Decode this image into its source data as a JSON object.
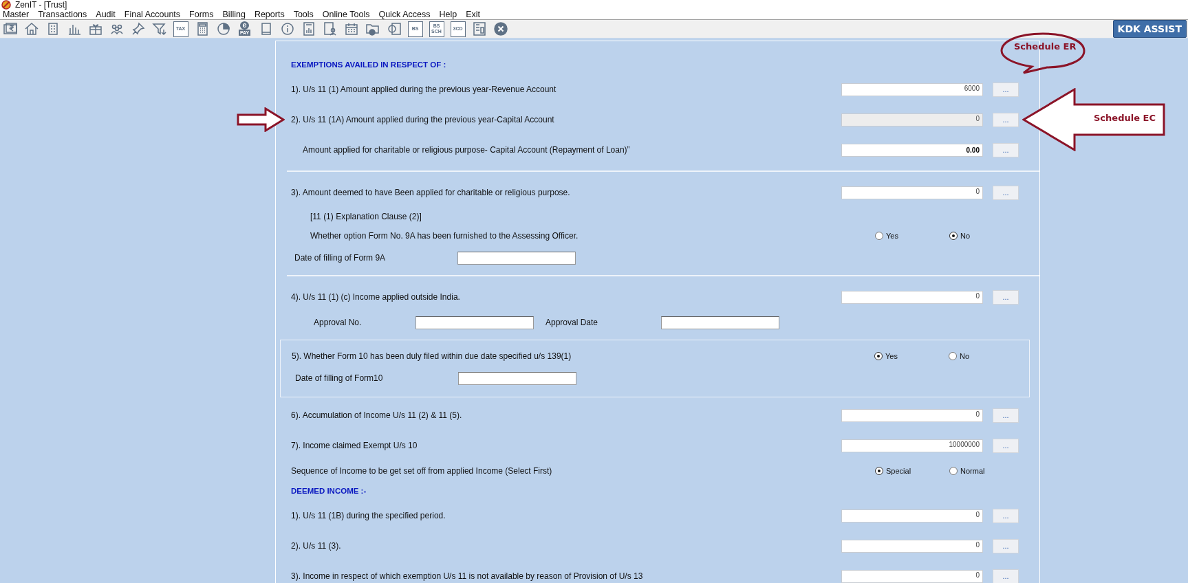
{
  "window": {
    "title": "ZenIT - [Trust]"
  },
  "menu": [
    "Master",
    "Transactions",
    "Audit",
    "Final Accounts",
    "Forms",
    "Billing",
    "Reports",
    "Tools",
    "Online Tools",
    "Quick Access",
    "Help",
    "Exit"
  ],
  "toolbar": [
    {
      "kind": "money"
    },
    {
      "kind": "home"
    },
    {
      "kind": "building"
    },
    {
      "kind": "chart"
    },
    {
      "kind": "gift"
    },
    {
      "kind": "people"
    },
    {
      "kind": "pin"
    },
    {
      "kind": "filter"
    },
    {
      "kind": "tag",
      "label": "TAX"
    },
    {
      "kind": "calculator"
    },
    {
      "kind": "pie"
    },
    {
      "kind": "epay",
      "mark": "e",
      "label": "PAY"
    },
    {
      "kind": "book"
    },
    {
      "kind": "info"
    },
    {
      "kind": "report"
    },
    {
      "kind": "user"
    },
    {
      "kind": "calendar"
    },
    {
      "kind": "folder"
    },
    {
      "kind": "window"
    },
    {
      "kind": "tag",
      "label": "BS"
    },
    {
      "kind": "tag2",
      "label": "BS",
      "sublabel": "SCH"
    },
    {
      "kind": "tag",
      "label": "3CD"
    },
    {
      "kind": "sheet"
    },
    {
      "kind": "close"
    }
  ],
  "assist_button": "KDK ASSIST",
  "rows": [
    {
      "kind": "heading",
      "text": "EXEMPTIONS AVAILED IN RESPECT OF :"
    },
    {
      "kind": "amount",
      "label": "1). U/s 11 (1) Amount applied during the previous year-Revenue Account",
      "value": "6000",
      "disabled": false,
      "emphasis": false,
      "button": "..."
    },
    {
      "kind": "amount",
      "label": "2). U/s 11 (1A) Amount applied during the previous year-Capital Account",
      "value": "0",
      "disabled": true,
      "emphasis": false,
      "button": "..."
    },
    {
      "kind": "sub_amount",
      "label": "Amount applied for charitable or religious purpose- Capital Account (Repayment of Loan)”",
      "value": "0.00",
      "disabled": false,
      "emphasis": true,
      "button": "..."
    },
    {
      "kind": "divider"
    },
    {
      "kind": "amount",
      "label": "3).  Amount deemed to have Been applied for charitable or religious purpose.",
      "value": "0",
      "disabled": false,
      "emphasis": false,
      "button": "..."
    },
    {
      "kind": "note",
      "text": "[11 (1) Explanation Clause (2)]"
    },
    {
      "kind": "choice",
      "indented": true,
      "label": "Whether option Form No. 9A has been furnished to the Assessing Officer.",
      "options": [
        {
          "label": "Yes",
          "selected": false
        },
        {
          "label": "No",
          "selected": true
        }
      ]
    },
    {
      "kind": "date",
      "label": "Date of filling of Form 9A"
    },
    {
      "kind": "divider"
    },
    {
      "kind": "amount",
      "label": "4).  U/s 11 (1) (c) Income applied outside India.",
      "value": "0",
      "disabled": false,
      "emphasis": false,
      "button": "..."
    },
    {
      "kind": "approval",
      "fields": [
        {
          "label": "Approval No."
        },
        {
          "label": "Approval Date"
        }
      ]
    },
    {
      "kind": "section",
      "rows": [
        {
          "kind": "choice",
          "indented": false,
          "label": "5). Whether Form 10 has been duly filed within due date specified u/s 139(1)",
          "options": [
            {
              "label": "Yes",
              "selected": true
            },
            {
              "label": "No",
              "selected": false
            }
          ]
        },
        {
          "kind": "date",
          "label": "Date of filling of Form10"
        }
      ]
    },
    {
      "kind": "amount",
      "label": "6).  Accumulation of Income U/s 11 (2) & 11 (5).",
      "value": "0",
      "disabled": false,
      "emphasis": false,
      "button": "..."
    },
    {
      "kind": "amount",
      "label": "7).  Income claimed Exempt U/s 10",
      "value": "10000000",
      "disabled": false,
      "emphasis": false,
      "button": "..."
    },
    {
      "kind": "choice",
      "indented": false,
      "label": "Sequence of Income to be get set off from applied Income (Select First)",
      "options": [
        {
          "label": "Special",
          "selected": true
        },
        {
          "label": "Normal",
          "selected": false
        }
      ]
    },
    {
      "kind": "heading",
      "text": "DEEMED INCOME :-"
    },
    {
      "kind": "amount",
      "label": "1).  U/s 11 (1B) during the specified period.",
      "value": "0",
      "disabled": false,
      "emphasis": false,
      "button": "..."
    },
    {
      "kind": "amount",
      "label": "2).  U/s 11 (3).",
      "value": "0",
      "disabled": false,
      "emphasis": false,
      "button": "..."
    },
    {
      "kind": "amount",
      "label": "3).  Income in respect of which exemption U/s 11 is not available by reason of Provision of U/s 13",
      "value": "0",
      "disabled": false,
      "emphasis": false,
      "button": "..."
    }
  ],
  "annotations": [
    {
      "kind": "bubble",
      "text": "Schedule ER"
    },
    {
      "kind": "left_arrow",
      "text": "Schedule EC"
    },
    {
      "kind": "right_arrow"
    }
  ]
}
